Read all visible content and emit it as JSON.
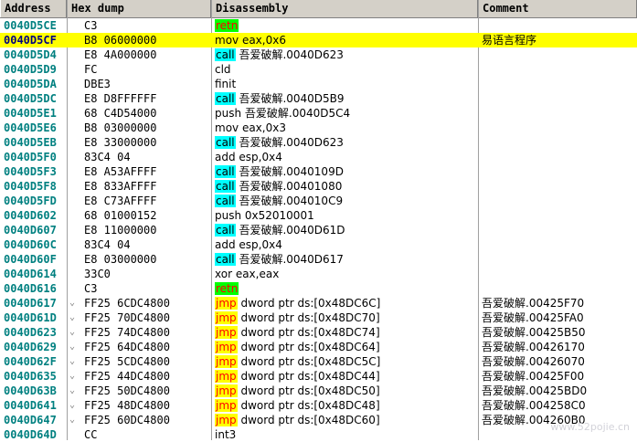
{
  "header": {
    "address": "Address",
    "hex": "Hex dump",
    "disasm": "Disassembly",
    "comment": "Comment"
  },
  "colors": {
    "retn_bg": "#00ff00",
    "retn_fg": "#ff0000",
    "call_bg": "#00ffff",
    "jmp_bg": "#ffff00",
    "jmp_fg": "#ff0000",
    "selected_row": "#ffff00",
    "address_text": "#008080"
  },
  "rows": [
    {
      "addr": "0040D5CE",
      "arrow": "",
      "hex": "C3",
      "kw": "retn",
      "kwtype": "retn",
      "rest": "",
      "comment": ""
    },
    {
      "addr": "0040D5CF",
      "arrow": "",
      "hex": "B8 06000000",
      "kw": "",
      "kwtype": "",
      "rest": "mov eax,0x6",
      "comment": "易语言程序",
      "selected": true
    },
    {
      "addr": "0040D5D4",
      "arrow": "",
      "hex": "E8 4A000000",
      "kw": "call",
      "kwtype": "call",
      "rest": " 吾爱破解.0040D623",
      "comment": ""
    },
    {
      "addr": "0040D5D9",
      "arrow": "",
      "hex": "FC",
      "kw": "",
      "kwtype": "",
      "rest": "cld",
      "comment": ""
    },
    {
      "addr": "0040D5DA",
      "arrow": "",
      "hex": "DBE3",
      "kw": "",
      "kwtype": "",
      "rest": "finit",
      "comment": ""
    },
    {
      "addr": "0040D5DC",
      "arrow": "",
      "hex": "E8 D8FFFFFF",
      "kw": "call",
      "kwtype": "call",
      "rest": " 吾爱破解.0040D5B9",
      "comment": ""
    },
    {
      "addr": "0040D5E1",
      "arrow": "",
      "hex": "68 C4D54000",
      "kw": "",
      "kwtype": "",
      "rest": "push 吾爱破解.0040D5C4",
      "comment": ""
    },
    {
      "addr": "0040D5E6",
      "arrow": "",
      "hex": "B8 03000000",
      "kw": "",
      "kwtype": "",
      "rest": "mov eax,0x3",
      "comment": ""
    },
    {
      "addr": "0040D5EB",
      "arrow": "",
      "hex": "E8 33000000",
      "kw": "call",
      "kwtype": "call",
      "rest": " 吾爱破解.0040D623",
      "comment": ""
    },
    {
      "addr": "0040D5F0",
      "arrow": "",
      "hex": "83C4 04",
      "kw": "",
      "kwtype": "",
      "rest": "add esp,0x4",
      "comment": ""
    },
    {
      "addr": "0040D5F3",
      "arrow": "",
      "hex": "E8 A53AFFFF",
      "kw": "call",
      "kwtype": "call",
      "rest": " 吾爱破解.0040109D",
      "comment": ""
    },
    {
      "addr": "0040D5F8",
      "arrow": "",
      "hex": "E8 833AFFFF",
      "kw": "call",
      "kwtype": "call",
      "rest": " 吾爱破解.00401080",
      "comment": ""
    },
    {
      "addr": "0040D5FD",
      "arrow": "",
      "hex": "E8 C73AFFFF",
      "kw": "call",
      "kwtype": "call",
      "rest": " 吾爱破解.004010C9",
      "comment": ""
    },
    {
      "addr": "0040D602",
      "arrow": "",
      "hex": "68 01000152",
      "kw": "",
      "kwtype": "",
      "rest": "push 0x52010001",
      "comment": ""
    },
    {
      "addr": "0040D607",
      "arrow": "",
      "hex": "E8 11000000",
      "kw": "call",
      "kwtype": "call",
      "rest": " 吾爱破解.0040D61D",
      "comment": ""
    },
    {
      "addr": "0040D60C",
      "arrow": "",
      "hex": "83C4 04",
      "kw": "",
      "kwtype": "",
      "rest": "add esp,0x4",
      "comment": ""
    },
    {
      "addr": "0040D60F",
      "arrow": "",
      "hex": "E8 03000000",
      "kw": "call",
      "kwtype": "call",
      "rest": " 吾爱破解.0040D617",
      "comment": ""
    },
    {
      "addr": "0040D614",
      "arrow": "",
      "hex": "33C0",
      "kw": "",
      "kwtype": "",
      "rest": "xor eax,eax",
      "comment": ""
    },
    {
      "addr": "0040D616",
      "arrow": "",
      "hex": "C3",
      "kw": "retn",
      "kwtype": "retn",
      "rest": "",
      "comment": ""
    },
    {
      "addr": "0040D617",
      "arrow": "⌄",
      "hex": "FF25 6CDC4800",
      "kw": "jmp",
      "kwtype": "jmp",
      "rest": " dword ptr ds:[0x48DC6C]",
      "comment": "吾爱破解.00425F70"
    },
    {
      "addr": "0040D61D",
      "arrow": "⌄",
      "hex": "FF25 70DC4800",
      "kw": "jmp",
      "kwtype": "jmp",
      "rest": " dword ptr ds:[0x48DC70]",
      "comment": "吾爱破解.00425FA0"
    },
    {
      "addr": "0040D623",
      "arrow": "⌄",
      "hex": "FF25 74DC4800",
      "kw": "jmp",
      "kwtype": "jmp",
      "rest": " dword ptr ds:[0x48DC74]",
      "comment": "吾爱破解.00425B50"
    },
    {
      "addr": "0040D629",
      "arrow": "⌄",
      "hex": "FF25 64DC4800",
      "kw": "jmp",
      "kwtype": "jmp",
      "rest": " dword ptr ds:[0x48DC64]",
      "comment": "吾爱破解.00426170"
    },
    {
      "addr": "0040D62F",
      "arrow": "⌄",
      "hex": "FF25 5CDC4800",
      "kw": "jmp",
      "kwtype": "jmp",
      "rest": " dword ptr ds:[0x48DC5C]",
      "comment": "吾爱破解.00426070"
    },
    {
      "addr": "0040D635",
      "arrow": "⌄",
      "hex": "FF25 44DC4800",
      "kw": "jmp",
      "kwtype": "jmp",
      "rest": " dword ptr ds:[0x48DC44]",
      "comment": "吾爱破解.00425F00"
    },
    {
      "addr": "0040D63B",
      "arrow": "⌄",
      "hex": "FF25 50DC4800",
      "kw": "jmp",
      "kwtype": "jmp",
      "rest": " dword ptr ds:[0x48DC50]",
      "comment": "吾爱破解.00425BD0"
    },
    {
      "addr": "0040D641",
      "arrow": "⌄",
      "hex": "FF25 48DC4800",
      "kw": "jmp",
      "kwtype": "jmp",
      "rest": " dword ptr ds:[0x48DC48]",
      "comment": "吾爱破解.004258C0"
    },
    {
      "addr": "0040D647",
      "arrow": "⌄",
      "hex": "FF25 60DC4800",
      "kw": "jmp",
      "kwtype": "jmp",
      "rest": " dword ptr ds:[0x48DC60]",
      "comment": "吾爱破解.004260B0"
    },
    {
      "addr": "0040D64D",
      "arrow": "",
      "hex": "CC",
      "kw": "",
      "kwtype": "",
      "rest": "int3",
      "comment": ""
    }
  ],
  "watermark": "www.52pojie.cn"
}
